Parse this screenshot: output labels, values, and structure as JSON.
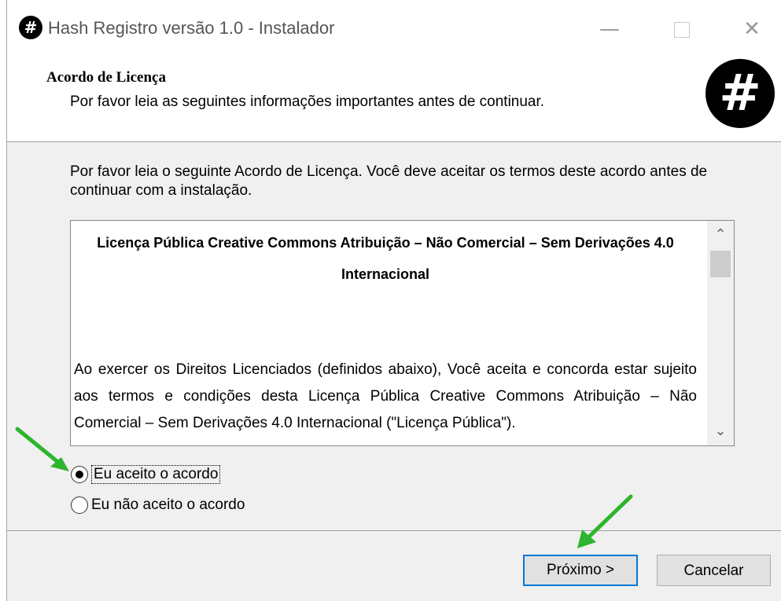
{
  "window": {
    "title": "Hash Registro versão 1.0 - Instalador",
    "icon_glyph": "#",
    "controls": {
      "minimize": "—",
      "close": "✕"
    }
  },
  "header": {
    "title": "Acordo de Licença",
    "subtitle": "Por favor leia as seguintes informações importantes antes de continuar.",
    "logo_glyph": "#"
  },
  "body": {
    "intro": "Por favor leia o seguinte Acordo de Licença. Você deve aceitar os termos deste acordo antes de continuar com a instalação.",
    "license": {
      "title": "Licença Pública Creative Commons Atribuição – Não Comercial – Sem Derivações 4.0 Internacional",
      "text": "Ao exercer os Direitos Licenciados (definidos abaixo), Você aceita e concorda estar sujeito aos termos e condições desta Licença Pública Creative Commons Atribuição – Não Comercial – Sem Derivações 4.0 Internacional (\"Licença Pública\")."
    },
    "scroll": {
      "up": "⌃",
      "down": "⌄"
    },
    "options": [
      {
        "label": "Eu aceito o acordo",
        "selected": true
      },
      {
        "label": "Eu não aceito o acordo",
        "selected": false
      }
    ]
  },
  "footer": {
    "next_label": "Próximo >",
    "cancel_label": "Cancelar"
  },
  "colors": {
    "annotation_arrow": "#2db52d",
    "focus_border": "#0078d7"
  }
}
